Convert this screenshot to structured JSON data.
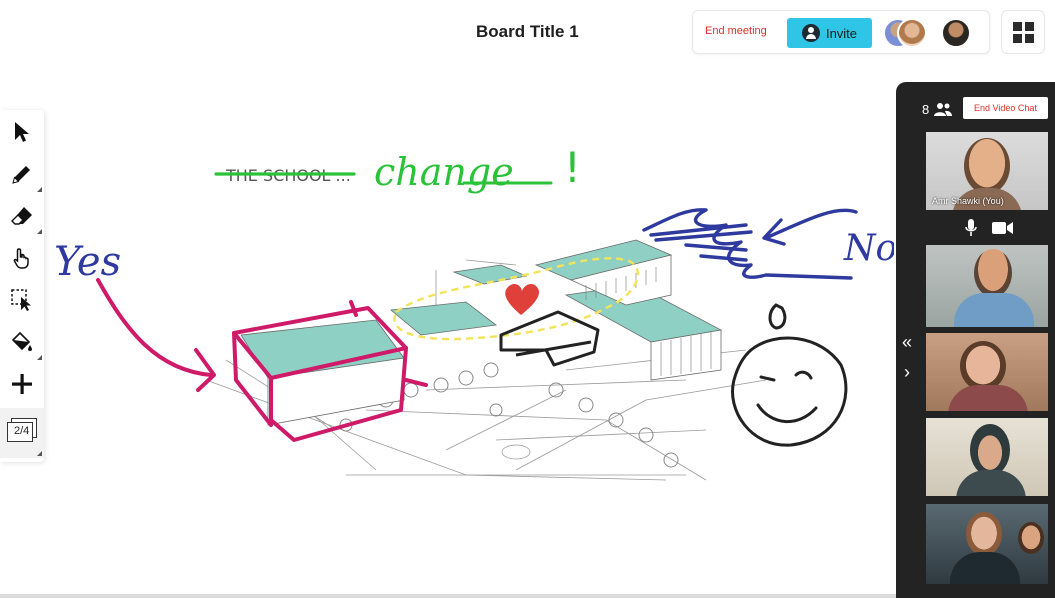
{
  "header": {
    "board_title": "Board Title 1",
    "end_meeting_label": "End meeting",
    "invite_label": "Invite",
    "accent_color": "#2ec5e6",
    "end_color": "#d9302a"
  },
  "toolbar": {
    "tools": [
      {
        "name": "select-tool",
        "icon": "arrow-pointer-icon"
      },
      {
        "name": "pen-tool",
        "icon": "pencil-icon"
      },
      {
        "name": "eraser-tool",
        "icon": "eraser-icon"
      },
      {
        "name": "pan-tool",
        "icon": "hand-pointer-icon"
      },
      {
        "name": "area-select-tool",
        "icon": "marquee-select-icon"
      },
      {
        "name": "fill-tool",
        "icon": "paint-bucket-icon"
      },
      {
        "name": "add-tool",
        "icon": "plus-icon"
      }
    ],
    "pages_label": "2/4"
  },
  "canvas": {
    "strike_text": "THE SCHOOL ...",
    "change_text": "change",
    "exclaim": "!",
    "yes_text": "Yes",
    "no_text": "No",
    "colors": {
      "green": "#2bc23a",
      "blue": "#2e3a9e",
      "magenta": "#cf1a6a",
      "teal": "#8fd0c4",
      "yellow": "#f2e35a",
      "heart": "#e0403a"
    }
  },
  "video": {
    "participant_count": "8",
    "end_video_chat_label": "End Video Chat",
    "self_name": "Amr Shawki (You)",
    "collapse_icon": "double-chevron-left-icon",
    "expand_icon": "chevron-right-icon"
  }
}
